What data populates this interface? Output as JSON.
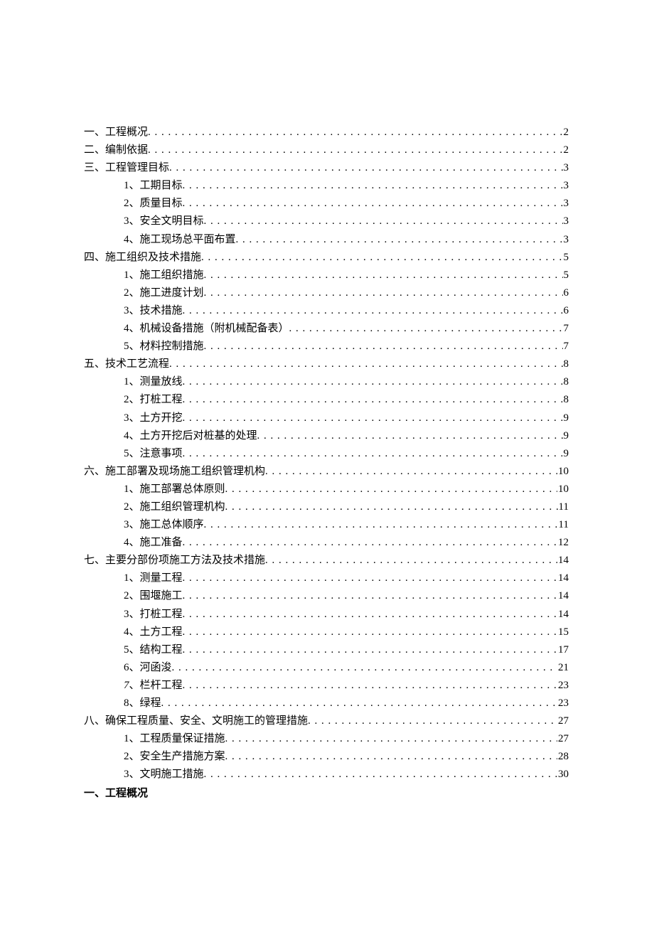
{
  "toc": [
    {
      "level": 1,
      "label": "一、工程概况",
      "page": "2"
    },
    {
      "level": 1,
      "label": "二、编制依据",
      "page": "2"
    },
    {
      "level": 1,
      "label": "三、工程管理目标",
      "page": "3"
    },
    {
      "level": 2,
      "label": "1、工期目标",
      "page": "3"
    },
    {
      "level": 2,
      "label": "2、质量目标",
      "page": "3"
    },
    {
      "level": 2,
      "label": "3、安全文明目标",
      "page": "3"
    },
    {
      "level": 2,
      "label": "4、施工现场总平面布置",
      "page": "3"
    },
    {
      "level": 1,
      "label": "四、施工组织及技术措施",
      "page": "5"
    },
    {
      "level": 2,
      "label": "1、施工组织措施",
      "page": "5"
    },
    {
      "level": 2,
      "label": "2、施工进度计划",
      "page": "6"
    },
    {
      "level": 2,
      "label": "3、技术措施",
      "page": "6"
    },
    {
      "level": 2,
      "label": "4、机械设备措施（附机械配备表）",
      "page": "7"
    },
    {
      "level": 2,
      "label": "5、材料控制措施",
      "page": "7"
    },
    {
      "level": 1,
      "label": "五、技术工艺流程",
      "page": "8"
    },
    {
      "level": 2,
      "label": "1、测量放线",
      "page": "8"
    },
    {
      "level": 2,
      "label": "2、打桩工程",
      "page": "8"
    },
    {
      "level": 2,
      "label": "3、土方开挖",
      "page": "9"
    },
    {
      "level": 2,
      "label": "4、土方开挖后对桩基的处理",
      "page": "9"
    },
    {
      "level": 2,
      "label": "5、注意事项",
      "page": "9"
    },
    {
      "level": 1,
      "label": "六、施工部署及现场施工组织管理机构",
      "page": "10"
    },
    {
      "level": 2,
      "label": "1、施工部署总体原则",
      "page": "10"
    },
    {
      "level": 2,
      "label": "2、施工组织管理机构",
      "page": "11"
    },
    {
      "level": 2,
      "label": "3、施工总体顺序",
      "page": "11"
    },
    {
      "level": 2,
      "label": "4、施工准备",
      "page": "12"
    },
    {
      "level": 1,
      "label": "七、主要分部份项施工方法及技术措施",
      "page": "14"
    },
    {
      "level": 2,
      "label": "1、测量工程",
      "page": "14"
    },
    {
      "level": 2,
      "label": "2、围堰施工",
      "page": "14"
    },
    {
      "level": 2,
      "label": "3、打桩工程",
      "page": "14"
    },
    {
      "level": 2,
      "label": "4、土方工程",
      "page": "15"
    },
    {
      "level": 2,
      "label": "5、结构工程",
      "page": "17"
    },
    {
      "level": 2,
      "label": "6、河函浚",
      "page": "21"
    },
    {
      "level": 2,
      "label_html": "<span class=\"italic-num\">7</span>、栏杆工程",
      "label": "7、栏杆工程",
      "page": "23"
    },
    {
      "level": 2,
      "label": "8、绿程",
      "page": "23"
    },
    {
      "level": 1,
      "label": "八、确保工程质量、安全、文明施工的管理措施",
      "page": "27"
    },
    {
      "level": 2,
      "label": "1、工程质量保证措施",
      "page": "27"
    },
    {
      "level": 2,
      "label": "2、安全生产措施方案",
      "page": "28"
    },
    {
      "level": 2,
      "label": "3、文明施工措施",
      "page": "30"
    }
  ],
  "body_heading": "一、工程概况"
}
